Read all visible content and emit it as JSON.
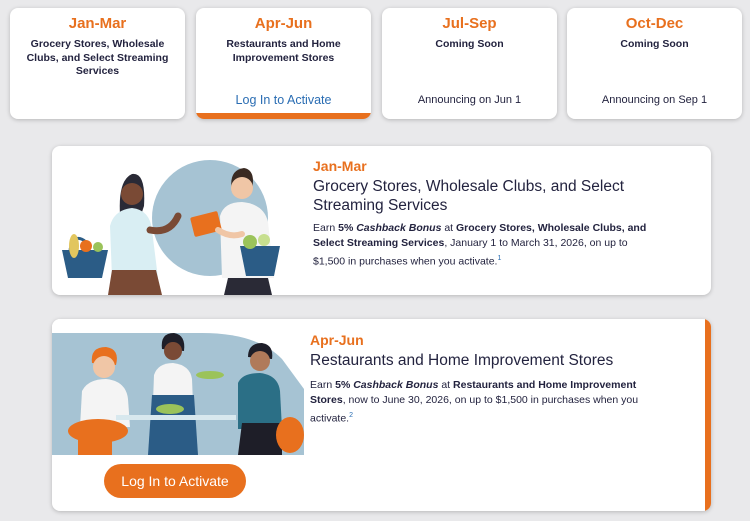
{
  "tiles": [
    {
      "title": "Jan-Mar",
      "desc": "Grocery Stores, Wholesale Clubs, and Select Streaming Services"
    },
    {
      "title": "Apr-Jun",
      "desc": "Restaurants and Home Improvement Stores",
      "link": "Log In to Activate"
    },
    {
      "title": "Jul-Sep",
      "desc": "Coming Soon",
      "foot": "Announcing on Jun 1"
    },
    {
      "title": "Oct-Dec",
      "desc": "Coming Soon",
      "foot": "Announcing on Sep 1"
    }
  ],
  "offers": [
    {
      "period": "Jan-Mar",
      "title": "Grocery Stores, Wholesale Clubs, and Select Streaming Services",
      "earn": "Earn ",
      "pct": "5%",
      "bonus": "Cashback Bonus",
      "at": " at ",
      "merchants": "Grocery Stores, Wholesale Clubs, and Select Streaming Services",
      "rest": ", January 1 to March 31, 2026, on up to $1,500 in purchases when you activate.",
      "footnote": "1"
    },
    {
      "period": "Apr-Jun",
      "title": "Restaurants and Home Improvement Stores",
      "earn": "Earn ",
      "pct": "5%",
      "bonus": "Cashback Bonus",
      "at": " at ",
      "merchants": "Restaurants and Home Improvement Stores",
      "rest": ", now to June 30, 2026, on up to $1,500 in purchases when you activate.",
      "footnote": "2",
      "button": "Log In to Activate"
    }
  ],
  "colors": {
    "accent": "#e8701e",
    "link": "#2a6db3",
    "text": "#23233f",
    "background": "#e9e9eb"
  }
}
